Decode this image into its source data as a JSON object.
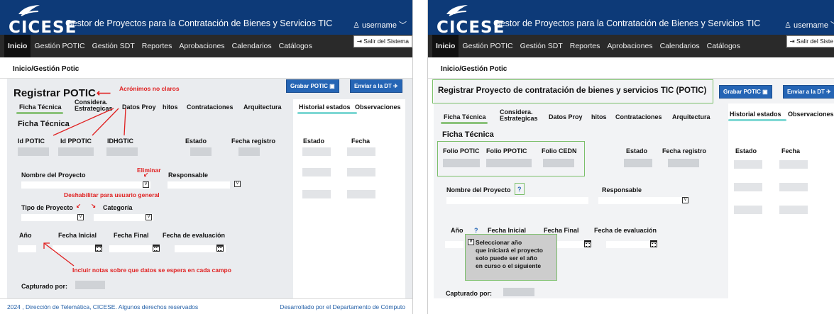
{
  "app": {
    "logo_text": "CICESE",
    "title": "Gestor de Proyectos para la Contratación de Bienes y Servicios TIC",
    "username": "username",
    "logout": "Salir del Sistema",
    "nav": [
      "Inicio",
      "Gestión POTIC",
      "Gestión SDT",
      "Reportes",
      "Aprobaciones",
      "Calendarios",
      "Catálogos"
    ],
    "breadcrumb": "Inicio/Gestión Potic"
  },
  "buttons": {
    "save": "Grabar POTIC",
    "send": "Enviar a la DT"
  },
  "left": {
    "page_title": "Registrar POTIC",
    "tabs": [
      "Ficha Técnica",
      "Considera.",
      "Estrategicas",
      "Datos Proy",
      "hitos",
      "Contrataciones",
      "Arquitectura"
    ],
    "right_tabs": [
      "Historial estados",
      "Observaciones"
    ],
    "section": "Ficha Técnica",
    "fields": {
      "id_potic": "Id POTIC",
      "id_ppotic": "Id PPOTIC",
      "idhgtic": "IDHGTIC",
      "estado": "Estado",
      "fecha_registro": "Fecha registro",
      "nombre": "Nombre del Proyecto",
      "responsable": "Responsable",
      "tipo": "Tipo de Proyecto",
      "categoria": "Categoría",
      "anio": "Año",
      "fecha_inicial": "Fecha Inicial",
      "fecha_final": "Fecha Final",
      "fecha_eval": "Fecha de evaluación",
      "capturado": "Capturado por:"
    },
    "history_cols": [
      "Estado",
      "Fecha"
    ],
    "annotations": {
      "acronimos": "Acrónimos no claros",
      "eliminar": "Eliminar",
      "deshabilitar": "Deshabilitar para usuario general",
      "incluir": "Incluir  notas sobre que datos se espera en cada campo"
    },
    "dropdown_glyph": "V",
    "footer_left": "2024 , Dirección de Telemática, CICESE. Algunos derechos reservados",
    "footer_right": "Desarrollado por el Departamento de Cómputo"
  },
  "right": {
    "page_title": "Registrar Proyecto de contratación de bienes y servicios TIC (POTIC)",
    "tabs": [
      "Ficha Técnica",
      "Considera.",
      "Estrategicas",
      "Datos Proy",
      "hitos",
      "Contrataciones",
      "Arquitectura"
    ],
    "right_tabs": [
      "Historial estados",
      "Observaciones"
    ],
    "section": "Ficha Técnica",
    "fields": {
      "folio_potic": "Folio POTIC",
      "folio_ppotic": "Folio  PPOTIC",
      "folio_cedn": "Folio CEDN",
      "estado": "Estado",
      "fecha_registro": "Fecha registro",
      "nombre": "Nombre del Proyecto",
      "help": "?",
      "responsable": "Responsable",
      "anio": "Año",
      "fecha_inicial": "Fecha Inicial",
      "fecha_final": "Fecha Final",
      "fecha_eval": "Fecha de evaluación",
      "capturado": "Capturado por:"
    },
    "history_cols": [
      "Estado",
      "Fecha"
    ],
    "tooltip": [
      "Seleccionar año",
      "que iniciará el proyecto",
      "solo puede ser el año",
      "en curso o el siguiente"
    ],
    "dropdown_glyph": "V",
    "user_truncated": "username",
    "logout_truncated": "Salir del Siste",
    "send_truncated": "Enviar a la DT"
  },
  "colors": {
    "header": "#0d3a78",
    "nav": "#2a2a2a",
    "button": "#2565b5",
    "annotation": "#e02020",
    "green_outline": "#7bbf6a",
    "teal_underline": "#7fd8d4"
  }
}
